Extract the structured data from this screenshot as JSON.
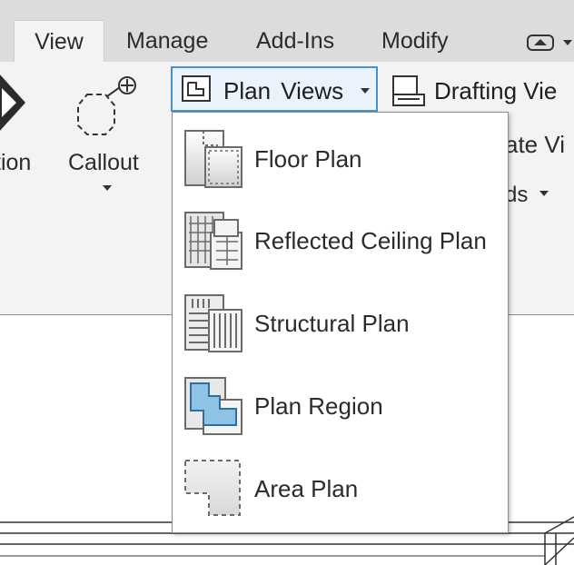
{
  "tabs": [
    {
      "label": "View",
      "active": true
    },
    {
      "label": "Manage",
      "active": false
    },
    {
      "label": "Add-Ins",
      "active": false
    },
    {
      "label": "Modify",
      "active": false
    }
  ],
  "ribbon": {
    "section_label_fragment": "tion",
    "callout_label": "Callout",
    "plan_views_label": "Plan Views",
    "drafting_label": "Drafting Vie",
    "duplicate_fragment": "ate Vi",
    "elements_fragment": "ds"
  },
  "dropdown": {
    "items": [
      {
        "label": "Floor Plan",
        "icon": "floor-plan-icon"
      },
      {
        "label": "Reflected Ceiling Plan",
        "icon": "reflected-ceiling-plan-icon"
      },
      {
        "label": "Structural Plan",
        "icon": "structural-plan-icon"
      },
      {
        "label": "Plan Region",
        "icon": "plan-region-icon"
      },
      {
        "label": "Area Plan",
        "icon": "area-plan-icon"
      }
    ]
  },
  "colors": {
    "tab_strip": "#dcdcdc",
    "ribbon_bg": "#f3f3f3",
    "selected_button_border": "#4a90d0",
    "selected_button_bg": "#eaf2fb",
    "plan_region_fill": "#8ec3e6"
  }
}
